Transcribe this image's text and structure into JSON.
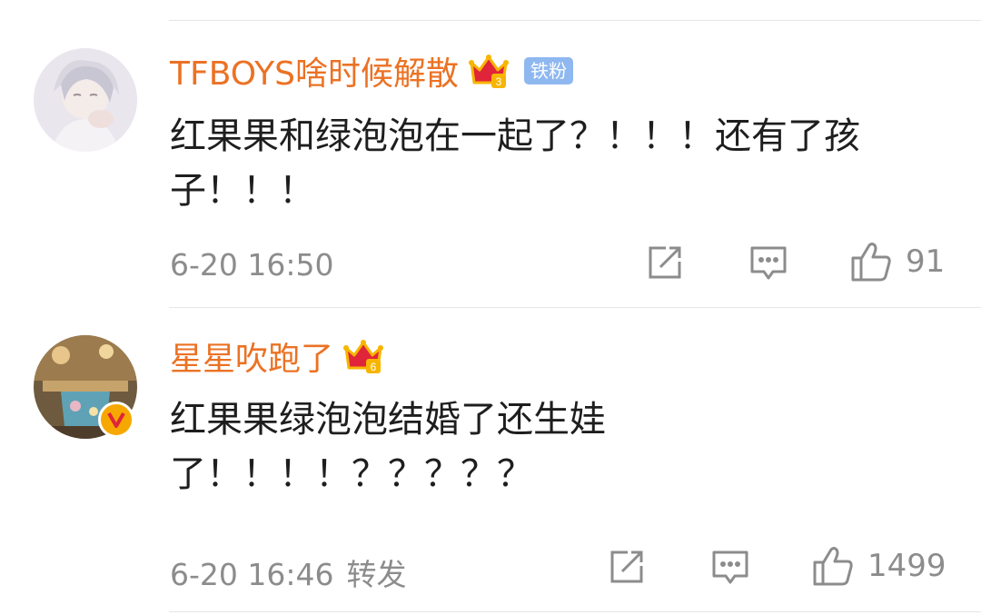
{
  "comments": [
    {
      "username": "TFBOYS啥时候解散",
      "crown_level": "3",
      "fan_badge": "铁粉",
      "text": "红果果和绿泡泡在一起了？！！！还有了孩\n子！！！",
      "time": "6-20 16:50",
      "repost_label": "",
      "likes": "91"
    },
    {
      "username": "星星吹跑了",
      "crown_level": "6",
      "text": "红果果绿泡泡结婚了还生娃\n了！！！！？？？？？",
      "time": "6-20 16:46",
      "repost_label": "转发",
      "likes": "1499"
    }
  ],
  "colors": {
    "username": "#eb7224",
    "fan_badge_bg": "#8fb8f0",
    "meta_gray": "#8c8c8c",
    "verified_badge": "#f6a800",
    "crown_red": "#e0243a",
    "crown_gold": "#f7b500"
  },
  "icons": {
    "share": "share-square-arrow-icon",
    "comment": "comment-bubble-icon",
    "like": "thumbs-up-icon",
    "crown": "crown-icon",
    "verified": "verified-v-icon"
  }
}
